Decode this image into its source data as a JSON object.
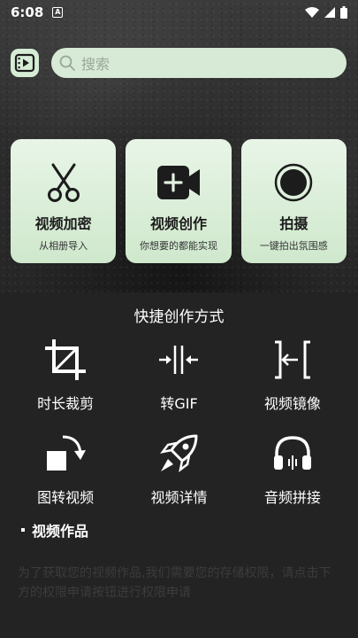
{
  "status_bar": {
    "time": "6:08",
    "notification_letter": "A"
  },
  "header": {
    "search_placeholder": "搜索"
  },
  "cards": [
    {
      "icon": "scissors-icon",
      "title": "视频加密",
      "subtitle": "从相册导入"
    },
    {
      "icon": "video-add-icon",
      "title": "视频创作",
      "subtitle": "你想要的都能实现"
    },
    {
      "icon": "record-icon",
      "title": "拍摄",
      "subtitle": "一键拍出氛围感"
    }
  ],
  "quick": {
    "title": "快捷创作方式",
    "tools": [
      {
        "icon": "crop-icon",
        "label": "时长裁剪"
      },
      {
        "icon": "compress-arrows-icon",
        "label": "转GIF"
      },
      {
        "icon": "mirror-icon",
        "label": "视频镜像"
      },
      {
        "icon": "rotate-image-icon",
        "label": "图转视频"
      },
      {
        "icon": "rocket-icon",
        "label": "视频详情"
      },
      {
        "icon": "headphones-icon",
        "label": "音频拼接"
      }
    ]
  },
  "works": {
    "label": "视频作品",
    "permission_text": "为了获取您的视频作品,我们需要您的存储权限，请点击下方的权限申请按钮进行权限申请"
  },
  "colors": {
    "accent": "#d6ecd5",
    "background": "#232323"
  }
}
